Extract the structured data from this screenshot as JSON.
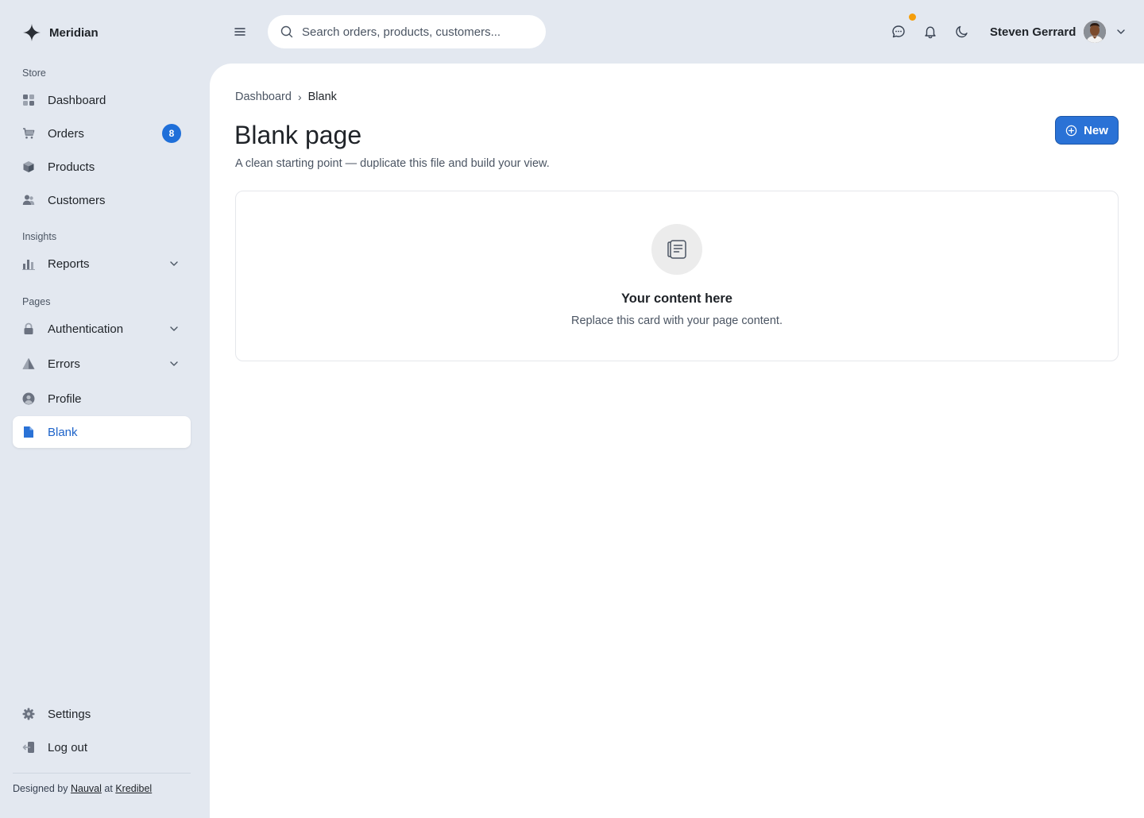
{
  "brand": {
    "name": "Meridian"
  },
  "sidebar": {
    "sections": [
      {
        "label": "Store"
      },
      {
        "label": "Insights"
      },
      {
        "label": "Pages"
      }
    ],
    "items": [
      {
        "label": "Dashboard",
        "icon": "dashboard-icon"
      },
      {
        "label": "Orders",
        "icon": "cart-icon",
        "badge": "8"
      },
      {
        "label": "Products",
        "icon": "box-icon"
      },
      {
        "label": "Customers",
        "icon": "users-icon"
      },
      {
        "label": "Reports",
        "icon": "bar-chart-icon",
        "expandable": true
      },
      {
        "label": "Authentication",
        "icon": "lock-icon",
        "expandable": true
      },
      {
        "label": "Errors",
        "icon": "warning-icon",
        "expandable": true
      },
      {
        "label": "Profile",
        "icon": "user-circle-icon"
      },
      {
        "label": "Blank",
        "icon": "file-icon",
        "active": true
      }
    ],
    "bottom_items": [
      {
        "label": "Settings",
        "icon": "gear-icon"
      },
      {
        "label": "Log out",
        "icon": "logout-icon"
      }
    ],
    "footer": {
      "prefix": "Designed by",
      "author": "Nauval",
      "middle": "at",
      "company": "Kredibel"
    }
  },
  "topbar": {
    "search_placeholder": "Search orders, products, customers...",
    "user_name": "Steven Gerrard"
  },
  "main": {
    "breadcrumb": [
      "Dashboard",
      "Blank"
    ],
    "title": "Blank page",
    "subtitle": "A clean starting point — duplicate this file and build your view.",
    "new_button_label": "New",
    "card": {
      "title": "Your content here",
      "text": "Replace this card with your page content."
    }
  },
  "colors": {
    "accent": "#1f6fd9",
    "background": "#e3e8f0",
    "notification_dot": "#f59e0b"
  }
}
